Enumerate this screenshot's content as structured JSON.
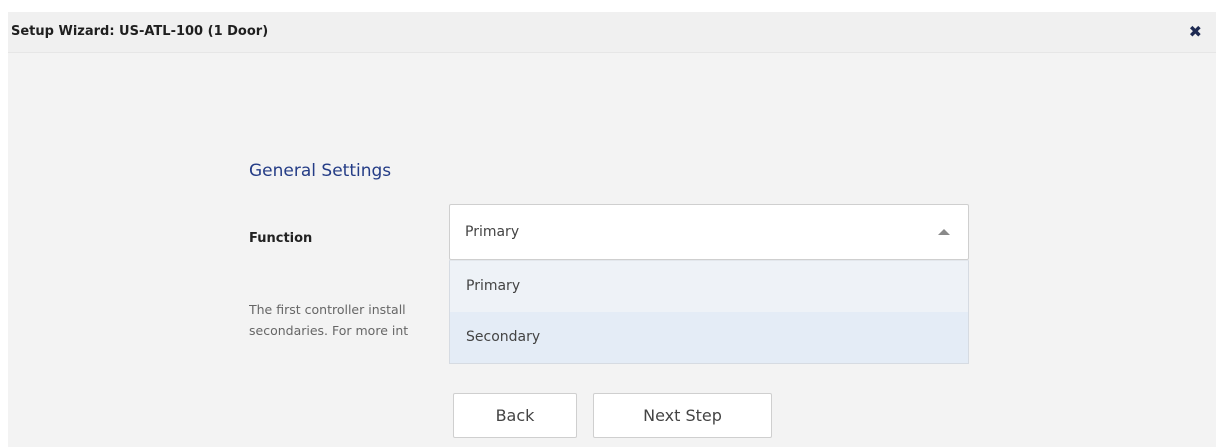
{
  "dialog": {
    "title": "Setup Wizard: US-ATL-100 (1 Door)",
    "close_icon": "close-icon"
  },
  "section": {
    "title": "General Settings"
  },
  "function_field": {
    "label": "Function",
    "selected_value": "Primary",
    "options": [
      "Primary",
      "Secondary"
    ],
    "highlighted_option": "Secondary"
  },
  "help": {
    "line1": "The first controller install",
    "line2": "secondaries. For more int"
  },
  "buttons": {
    "back": "Back",
    "next": "Next Step"
  }
}
